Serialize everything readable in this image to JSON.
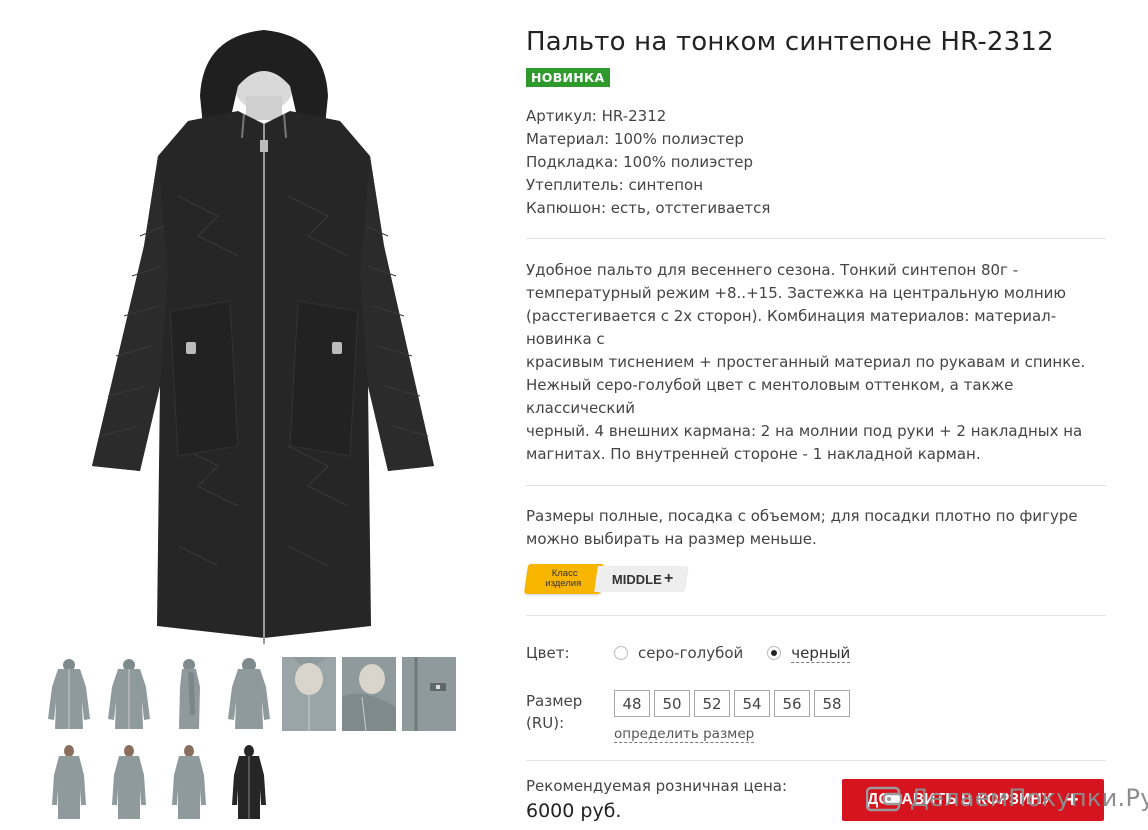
{
  "product": {
    "title": "Пальто на тонком синтепоне HR-2312",
    "badge": "НОВИНКА",
    "specs": [
      "Артикул: HR-2312",
      "Материал: 100% полиэстер",
      "Подкладка: 100% полиэстер",
      "Утеплитель: синтепон",
      "Капюшон: есть, отстегивается"
    ],
    "description_lines": [
      "Удобное пальто для весеннего сезона. Тонкий синтепон 80г -",
      "температурный режим +8..+15. Застежка на центральную молнию",
      "(расстегивается с 2х сторон). Комбинация материалов: материал-новинка с",
      "красивым тиснением + простеганный материал по рукавам и спинке.",
      "Нежный серо-голубой цвет с ментоловым оттенком, а также классический",
      "черный. 4 внешних кармана: 2 на молнии под руки + 2 накладных на",
      "магнитах. По внутренней стороне - 1 накладной карман."
    ],
    "size_note_lines": [
      "Размеры полные, посадка с объемом; для посадки плотно по фигуре",
      "можно выбирать на размер меньше."
    ],
    "class_badge": {
      "label_line1": "Класс",
      "label_line2": "изделия",
      "value": "MIDDLE",
      "plus": "+"
    },
    "color": {
      "label": "Цвет:",
      "options": [
        {
          "label": "серо-голубой",
          "selected": false
        },
        {
          "label": "черный",
          "selected": true
        }
      ]
    },
    "size": {
      "label_line1": "Размер",
      "label_line2": "(RU):",
      "options": [
        "48",
        "50",
        "52",
        "54",
        "56",
        "58"
      ],
      "link": "определить размер"
    },
    "price": {
      "label": "Рекомендуемая розничная цена:",
      "value": "6000 руб."
    },
    "cart_button": {
      "label": "ДОБАВИТЬ В КОРЗИНУ",
      "plus": "+"
    }
  },
  "gallery": {
    "thumbs": [
      {
        "color": "#8e9a9c",
        "kind": "front"
      },
      {
        "color": "#8e9a9c",
        "kind": "front"
      },
      {
        "color": "#8e9a9c",
        "kind": "side"
      },
      {
        "color": "#8e9a9c",
        "kind": "back"
      },
      {
        "color": "#8e9a9c",
        "kind": "closeup"
      },
      {
        "color": "#8e9a9c",
        "kind": "closeup"
      },
      {
        "color": "#8e9a9c",
        "kind": "closeup"
      },
      {
        "color": "#8e9a9c",
        "kind": "model"
      },
      {
        "color": "#8e9a9c",
        "kind": "model"
      },
      {
        "color": "#8e9a9c",
        "kind": "model"
      },
      {
        "color": "#262626",
        "kind": "front"
      }
    ]
  },
  "watermark": "ДелаемПокупки.Ру",
  "colors": {
    "accent_red": "#d6141f",
    "badge_green": "#2d9a2b",
    "class_yellow": "#f7b500",
    "coat_black": "#262626",
    "coat_grey": "#8e9a9c"
  }
}
